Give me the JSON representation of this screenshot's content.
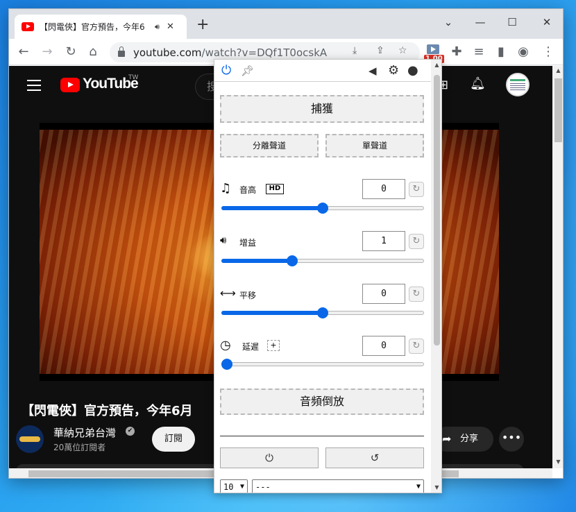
{
  "browser": {
    "tab_title": "【閃電俠】官方預告，今年6",
    "tab_audio_icon": "speaker-icon",
    "new_tab": "+",
    "min": "‿",
    "max": "☐",
    "close": "✕",
    "back": "←",
    "forward": "→",
    "reload": "↻",
    "home": "⌂",
    "url_host": "youtube.com",
    "url_path": "/watch?v=DQf1T0ocskA",
    "ext_badge": "1.00",
    "menu": "⋮"
  },
  "youtube": {
    "logo_text": "YouTube",
    "country": "TW",
    "search_placeholder": "搜",
    "video_title": "【閃電俠】官方預告，今年6月",
    "channel_name": "華納兄弟台灣",
    "verified": "✔",
    "subscribers": "20萬位訂閱者",
    "subscribe_label": "訂閱",
    "share_label": "分享",
    "more_label": "•••"
  },
  "popup": {
    "header_icons": [
      "power-icon",
      "pin-icon",
      "arrow-left-icon",
      "gear-icon",
      "github-icon"
    ],
    "capture_label": "捕獲",
    "split_channel_label": "分離聲道",
    "mono_label": "單聲道",
    "pitch": {
      "label": "音高",
      "badge": "HD",
      "value": "0",
      "slider_fraction": 0.5
    },
    "gain": {
      "label": "增益",
      "value": "1",
      "slider_fraction": 0.34
    },
    "pan": {
      "label": "平移",
      "value": "0",
      "slider_fraction": 0.5
    },
    "delay": {
      "label": "延遲",
      "badge": "+",
      "value": "0",
      "slider_fraction": 0.0
    },
    "reverse_label": "音頻倒放",
    "power_btn": "⏻",
    "reset_btn": "↺",
    "select_count": "10",
    "select_preset": "---"
  }
}
